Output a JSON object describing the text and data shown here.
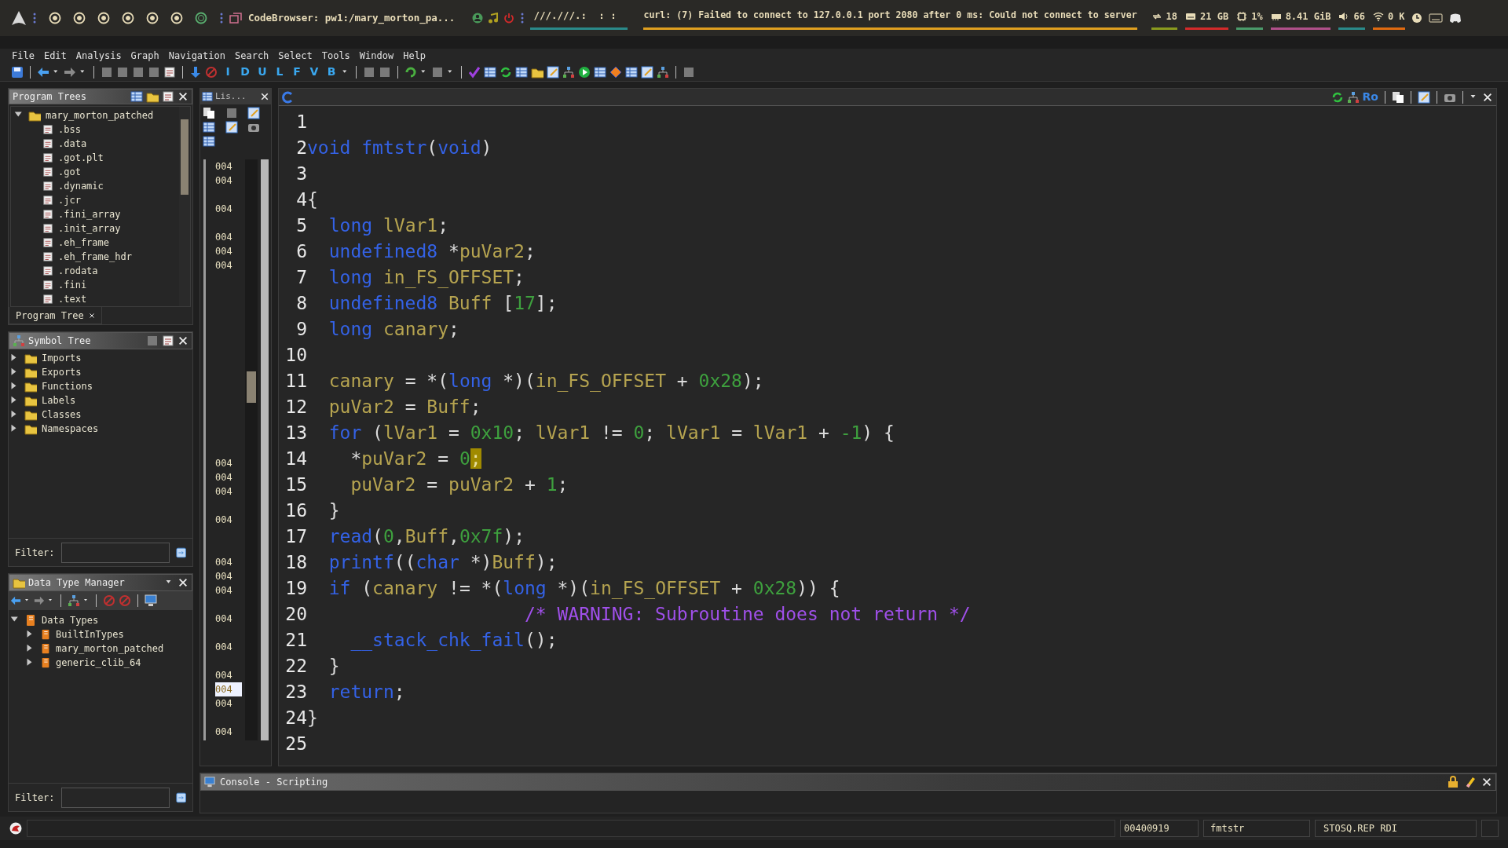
{
  "top_bar": {
    "workspaces": [
      {
        "selected": false
      },
      {
        "selected": false
      },
      {
        "selected": false
      },
      {
        "selected": false
      },
      {
        "selected": false
      },
      {
        "selected": false
      },
      {
        "selected": true
      }
    ],
    "window_title": "CodeBrowser: pw1:/mary_morton_pa...",
    "path_text": "///.///.:  : :",
    "notification": "curl: (7) Failed to connect to 127.0.0.1 port 2080 after 0 ms: Could not connect to server",
    "stats": [
      {
        "kind": "updates",
        "value": "18",
        "color": "#8a9a1e"
      },
      {
        "kind": "disk",
        "value": "21 GB",
        "color": "#d42a2a"
      },
      {
        "kind": "cpu",
        "value": "1%",
        "color": "#4a9a6a"
      },
      {
        "kind": "memory",
        "value": "8.41 GiB",
        "color": "#b0508a"
      },
      {
        "kind": "volume",
        "value": "66",
        "color": "#2a8a8a"
      },
      {
        "kind": "wifi",
        "value": "0 K",
        "color": "#e06a10"
      }
    ]
  },
  "menu": [
    "File",
    "Edit",
    "Analysis",
    "Graph",
    "Navigation",
    "Search",
    "Select",
    "Tools",
    "Window",
    "Help"
  ],
  "toolbar": {
    "letter_buttons": [
      "I",
      "D",
      "U",
      "L",
      "F",
      "V",
      "B"
    ]
  },
  "program_trees": {
    "title": "Program Trees",
    "root": {
      "label": "mary_morton_patched",
      "expanded": true,
      "children": [
        {
          "label": ".bss"
        },
        {
          "label": ".data"
        },
        {
          "label": ".got.plt"
        },
        {
          "label": ".got"
        },
        {
          "label": ".dynamic"
        },
        {
          "label": ".jcr"
        },
        {
          "label": ".fini_array"
        },
        {
          "label": ".init_array"
        },
        {
          "label": ".eh_frame"
        },
        {
          "label": ".eh_frame_hdr"
        },
        {
          "label": ".rodata"
        },
        {
          "label": ".fini"
        },
        {
          "label": ".text"
        }
      ]
    },
    "tab": "Program Tree"
  },
  "symbol_tree": {
    "title": "Symbol Tree",
    "items": [
      {
        "label": "Imports",
        "expanded": false
      },
      {
        "label": "Exports",
        "expanded": false
      },
      {
        "label": "Functions",
        "expanded": false
      },
      {
        "label": "Labels",
        "expanded": false
      },
      {
        "label": "Classes",
        "expanded": false
      },
      {
        "label": "Namespaces",
        "expanded": false
      }
    ],
    "filter_label": "Filter:"
  },
  "data_type_manager": {
    "title": "Data Type Manager",
    "root": {
      "label": "Data Types",
      "expanded": true,
      "children": [
        {
          "label": "BuiltInTypes",
          "expanded": false
        },
        {
          "label": "mary_morton_patched",
          "expanded": false
        },
        {
          "label": "generic_clib_64",
          "expanded": false
        }
      ]
    },
    "filter_label": "Filter:"
  },
  "listing": {
    "title": "Lis...",
    "rows": [
      {
        "kind": "address",
        "text": "004",
        "selected": false
      },
      {
        "kind": "address",
        "text": "004",
        "selected": false
      },
      {
        "kind": "blank"
      },
      {
        "kind": "address",
        "text": "004",
        "selected": false
      },
      {
        "kind": "blank"
      },
      {
        "kind": "address",
        "text": "004",
        "selected": false
      },
      {
        "kind": "address",
        "text": "004",
        "selected": false
      },
      {
        "kind": "address",
        "text": "004",
        "selected": false
      },
      {
        "kind": "blank"
      },
      {
        "kind": "blank"
      },
      {
        "kind": "blank"
      },
      {
        "kind": "blank"
      },
      {
        "kind": "blank"
      },
      {
        "kind": "blank"
      },
      {
        "kind": "blank"
      },
      {
        "kind": "blank"
      },
      {
        "kind": "blank"
      },
      {
        "kind": "blank"
      },
      {
        "kind": "blank"
      },
      {
        "kind": "blank"
      },
      {
        "kind": "blank"
      },
      {
        "kind": "address",
        "text": "004",
        "selected": false
      },
      {
        "kind": "address",
        "text": "004",
        "selected": false
      },
      {
        "kind": "address",
        "text": "004",
        "selected": false
      },
      {
        "kind": "blank"
      },
      {
        "kind": "address",
        "text": "004",
        "selected": false
      },
      {
        "kind": "blank"
      },
      {
        "kind": "blank"
      },
      {
        "kind": "address",
        "text": "004",
        "selected": false
      },
      {
        "kind": "address",
        "text": "004",
        "selected": false
      },
      {
        "kind": "address",
        "text": "004",
        "selected": false
      },
      {
        "kind": "blank"
      },
      {
        "kind": "address",
        "text": "004",
        "selected": false
      },
      {
        "kind": "blank"
      },
      {
        "kind": "address",
        "text": "004",
        "selected": false
      },
      {
        "kind": "blank"
      },
      {
        "kind": "address",
        "text": "004",
        "selected": false
      },
      {
        "kind": "address",
        "text": "004",
        "selected": true
      },
      {
        "kind": "address",
        "text": "004",
        "selected": false
      },
      {
        "kind": "blank"
      },
      {
        "kind": "address",
        "text": "004",
        "selected": false
      }
    ]
  },
  "decompiler": {
    "toolbar_text": "Ro",
    "lines": [
      {
        "number": "1"
      },
      {
        "number": "2",
        "tokens": [
          {
            "kind": "keyword",
            "text": "void"
          },
          {
            "kind": "keyword",
            "text": " fmtstr"
          },
          {
            "kind": "plain",
            "text": "("
          },
          {
            "kind": "keyword",
            "text": "void"
          },
          {
            "kind": "plain",
            "text": ")"
          }
        ]
      },
      {
        "number": "3"
      },
      {
        "number": "4",
        "tokens": [
          {
            "kind": "plain",
            "text": "{"
          }
        ]
      },
      {
        "number": "5",
        "tokens": [
          {
            "kind": "keyword",
            "text": "  long"
          },
          {
            "kind": "variable",
            "text": " lVar1"
          },
          {
            "kind": "plain",
            "text": ";"
          }
        ]
      },
      {
        "number": "6",
        "tokens": [
          {
            "kind": "keyword",
            "text": "  undefined8"
          },
          {
            "kind": "plain",
            "text": " *"
          },
          {
            "kind": "variable",
            "text": "puVar2"
          },
          {
            "kind": "plain",
            "text": ";"
          }
        ]
      },
      {
        "number": "7",
        "tokens": [
          {
            "kind": "keyword",
            "text": "  long"
          },
          {
            "kind": "variable",
            "text": " in_FS_OFFSET"
          },
          {
            "kind": "plain",
            "text": ";"
          }
        ]
      },
      {
        "number": "8",
        "tokens": [
          {
            "kind": "keyword",
            "text": "  undefined8"
          },
          {
            "kind": "variable",
            "text": " Buff "
          },
          {
            "kind": "plain",
            "text": "["
          },
          {
            "kind": "number",
            "text": "17"
          },
          {
            "kind": "plain",
            "text": "];"
          }
        ]
      },
      {
        "number": "9",
        "tokens": [
          {
            "kind": "keyword",
            "text": "  long"
          },
          {
            "kind": "variable",
            "text": " canary"
          },
          {
            "kind": "plain",
            "text": ";"
          }
        ]
      },
      {
        "number": "10"
      },
      {
        "number": "11",
        "tokens": [
          {
            "kind": "variable",
            "text": "  canary"
          },
          {
            "kind": "plain",
            "text": " = *("
          },
          {
            "kind": "keyword",
            "text": "long"
          },
          {
            "kind": "plain",
            "text": " *)("
          },
          {
            "kind": "variable",
            "text": "in_FS_OFFSET"
          },
          {
            "kind": "plain",
            "text": " + "
          },
          {
            "kind": "number",
            "text": "0x28"
          },
          {
            "kind": "plain",
            "text": ");"
          }
        ]
      },
      {
        "number": "12",
        "tokens": [
          {
            "kind": "variable",
            "text": "  puVar2"
          },
          {
            "kind": "plain",
            "text": " = "
          },
          {
            "kind": "variable",
            "text": "Buff"
          },
          {
            "kind": "plain",
            "text": ";"
          }
        ]
      },
      {
        "number": "13",
        "tokens": [
          {
            "kind": "keyword",
            "text": "  for"
          },
          {
            "kind": "plain",
            "text": " ("
          },
          {
            "kind": "variable",
            "text": "lVar1"
          },
          {
            "kind": "plain",
            "text": " = "
          },
          {
            "kind": "number",
            "text": "0x10"
          },
          {
            "kind": "plain",
            "text": "; "
          },
          {
            "kind": "variable",
            "text": "lVar1"
          },
          {
            "kind": "plain",
            "text": " != "
          },
          {
            "kind": "number",
            "text": "0"
          },
          {
            "kind": "plain",
            "text": "; "
          },
          {
            "kind": "variable",
            "text": "lVar1"
          },
          {
            "kind": "plain",
            "text": " = "
          },
          {
            "kind": "variable",
            "text": "lVar1"
          },
          {
            "kind": "plain",
            "text": " + "
          },
          {
            "kind": "number",
            "text": "-1"
          },
          {
            "kind": "plain",
            "text": ") {"
          }
        ]
      },
      {
        "number": "14",
        "tokens": [
          {
            "kind": "plain",
            "text": "    *"
          },
          {
            "kind": "variable",
            "text": "puVar2"
          },
          {
            "kind": "plain",
            "text": " = "
          },
          {
            "kind": "number",
            "text": "0"
          },
          {
            "kind": "cursor",
            "text": ";"
          }
        ]
      },
      {
        "number": "15",
        "tokens": [
          {
            "kind": "variable",
            "text": "    puVar2"
          },
          {
            "kind": "plain",
            "text": " = "
          },
          {
            "kind": "variable",
            "text": "puVar2"
          },
          {
            "kind": "plain",
            "text": " + "
          },
          {
            "kind": "number",
            "text": "1"
          },
          {
            "kind": "plain",
            "text": ";"
          }
        ]
      },
      {
        "number": "16",
        "tokens": [
          {
            "kind": "plain",
            "text": "  }"
          }
        ]
      },
      {
        "number": "17",
        "tokens": [
          {
            "kind": "keyword",
            "text": "  read"
          },
          {
            "kind": "plain",
            "text": "("
          },
          {
            "kind": "number",
            "text": "0"
          },
          {
            "kind": "plain",
            "text": ","
          },
          {
            "kind": "variable",
            "text": "Buff"
          },
          {
            "kind": "plain",
            "text": ","
          },
          {
            "kind": "number",
            "text": "0x7f"
          },
          {
            "kind": "plain",
            "text": ");"
          }
        ]
      },
      {
        "number": "18",
        "tokens": [
          {
            "kind": "keyword",
            "text": "  printf"
          },
          {
            "kind": "plain",
            "text": "(("
          },
          {
            "kind": "keyword",
            "text": "char"
          },
          {
            "kind": "plain",
            "text": " *)"
          },
          {
            "kind": "variable",
            "text": "Buff"
          },
          {
            "kind": "plain",
            "text": ");"
          }
        ]
      },
      {
        "number": "19",
        "tokens": [
          {
            "kind": "keyword",
            "text": "  if"
          },
          {
            "kind": "plain",
            "text": " ("
          },
          {
            "kind": "variable",
            "text": "canary"
          },
          {
            "kind": "plain",
            "text": " != *("
          },
          {
            "kind": "keyword",
            "text": "long"
          },
          {
            "kind": "plain",
            "text": " *)("
          },
          {
            "kind": "variable",
            "text": "in_FS_OFFSET"
          },
          {
            "kind": "plain",
            "text": " + "
          },
          {
            "kind": "number",
            "text": "0x28"
          },
          {
            "kind": "plain",
            "text": ")) {"
          }
        ]
      },
      {
        "number": "20",
        "tokens": [
          {
            "kind": "comment",
            "text": "                    /* WARNING: Subroutine does not return */"
          }
        ]
      },
      {
        "number": "21",
        "tokens": [
          {
            "kind": "keyword",
            "text": "    __stack_chk_fail"
          },
          {
            "kind": "plain",
            "text": "();"
          }
        ]
      },
      {
        "number": "22",
        "tokens": [
          {
            "kind": "plain",
            "text": "  }"
          }
        ]
      },
      {
        "number": "23",
        "tokens": [
          {
            "kind": "keyword",
            "text": "  return"
          },
          {
            "kind": "plain",
            "text": ";"
          }
        ]
      },
      {
        "number": "24",
        "tokens": [
          {
            "kind": "plain",
            "text": "}"
          }
        ]
      },
      {
        "number": "25"
      }
    ]
  },
  "console": {
    "title": "Console - Scripting"
  },
  "status_bar": {
    "address": "00400919",
    "function": "fmtstr",
    "instruction": "STOSQ.REP RDI"
  }
}
